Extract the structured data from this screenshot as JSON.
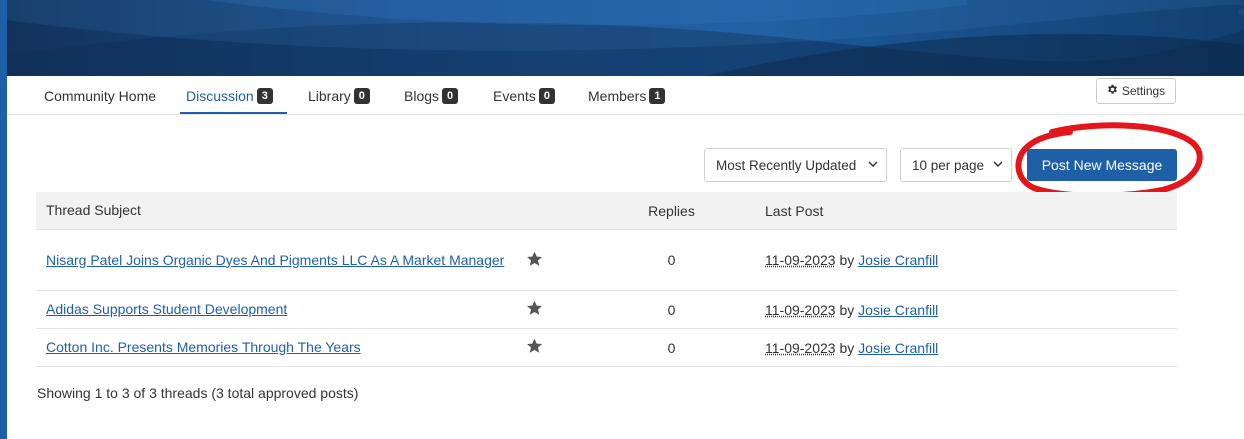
{
  "colors": {
    "accent": "#1f5fa8",
    "badge": "#333333",
    "annotation": "#e3161b"
  },
  "nav": {
    "tabs": [
      {
        "label": "Community Home",
        "count": ""
      },
      {
        "label": "Discussion",
        "count": "3"
      },
      {
        "label": "Library",
        "count": "0"
      },
      {
        "label": "Blogs",
        "count": "0"
      },
      {
        "label": "Events",
        "count": "0"
      },
      {
        "label": "Members",
        "count": "1"
      }
    ],
    "active_tab": "Discussion",
    "settings_label": "Settings",
    "settings_icon": "gear-icon"
  },
  "controls": {
    "sort_value": "Most Recently Updated",
    "per_page_value": "10 per page",
    "post_button_label": "Post New Message"
  },
  "table": {
    "headers": {
      "subject": "Thread Subject",
      "replies": "Replies",
      "last_post": "Last Post"
    },
    "rows": [
      {
        "subject": "Nisarg Patel Joins Organic Dyes And Pigments LLC As A Market Manager",
        "replies": "0",
        "date": "11-09-2023",
        "by": "by",
        "author": "Josie Cranfill"
      },
      {
        "subject": "Adidas Supports Student Development",
        "replies": "0",
        "date": "11-09-2023",
        "by": "by",
        "author": "Josie Cranfill"
      },
      {
        "subject": "Cotton Inc. Presents Memories Through The Years",
        "replies": "0",
        "date": "11-09-2023",
        "by": "by",
        "author": "Josie Cranfill"
      }
    ]
  },
  "footer": {
    "summary": "Showing 1 to 3 of 3 threads (3 total approved posts)"
  }
}
